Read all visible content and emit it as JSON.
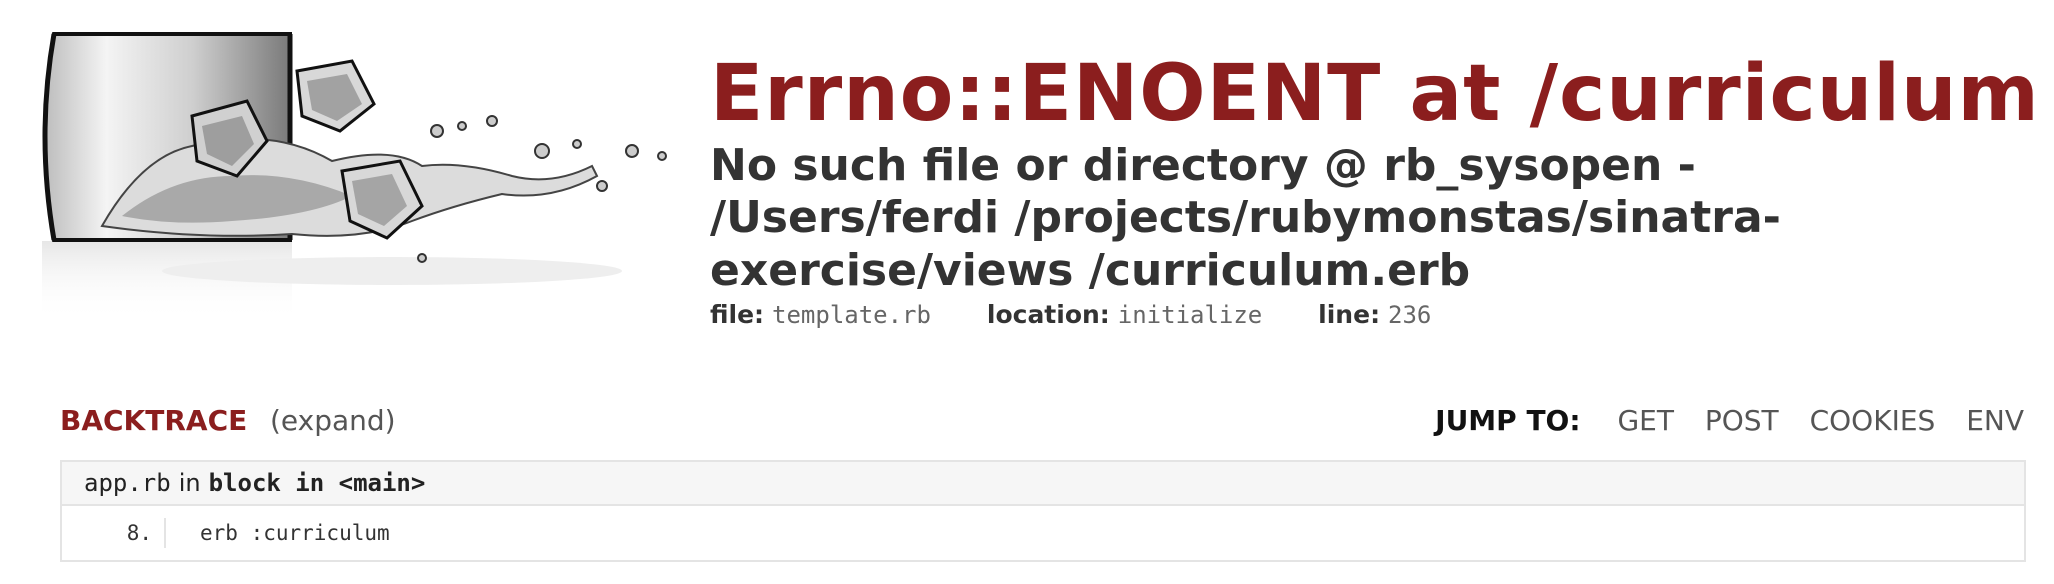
{
  "error": {
    "title": "Errno::ENOENT at /curriculum",
    "message": "No such file or directory @ rb_sysopen - /Users/ferdi /projects/rubymonstas/sinatra-exercise/views /curriculum.erb",
    "file_label": "file:",
    "file_value": "template.rb",
    "location_label": "location:",
    "location_value": "initialize",
    "line_label": "line:",
    "line_value": "236"
  },
  "backtrace": {
    "title": "BACKTRACE",
    "expand_label": "(expand)",
    "jump_label": "JUMP TO:",
    "jump_links": [
      "GET",
      "POST",
      "COOKIES",
      "ENV"
    ],
    "frames": [
      {
        "file": "app.rb",
        "in_label": "in",
        "context": "block in <main>",
        "line_number": "8.",
        "code": "erb :curriculum"
      }
    ]
  },
  "logo": {
    "icon": "sinatra-glass-splash-icon"
  }
}
